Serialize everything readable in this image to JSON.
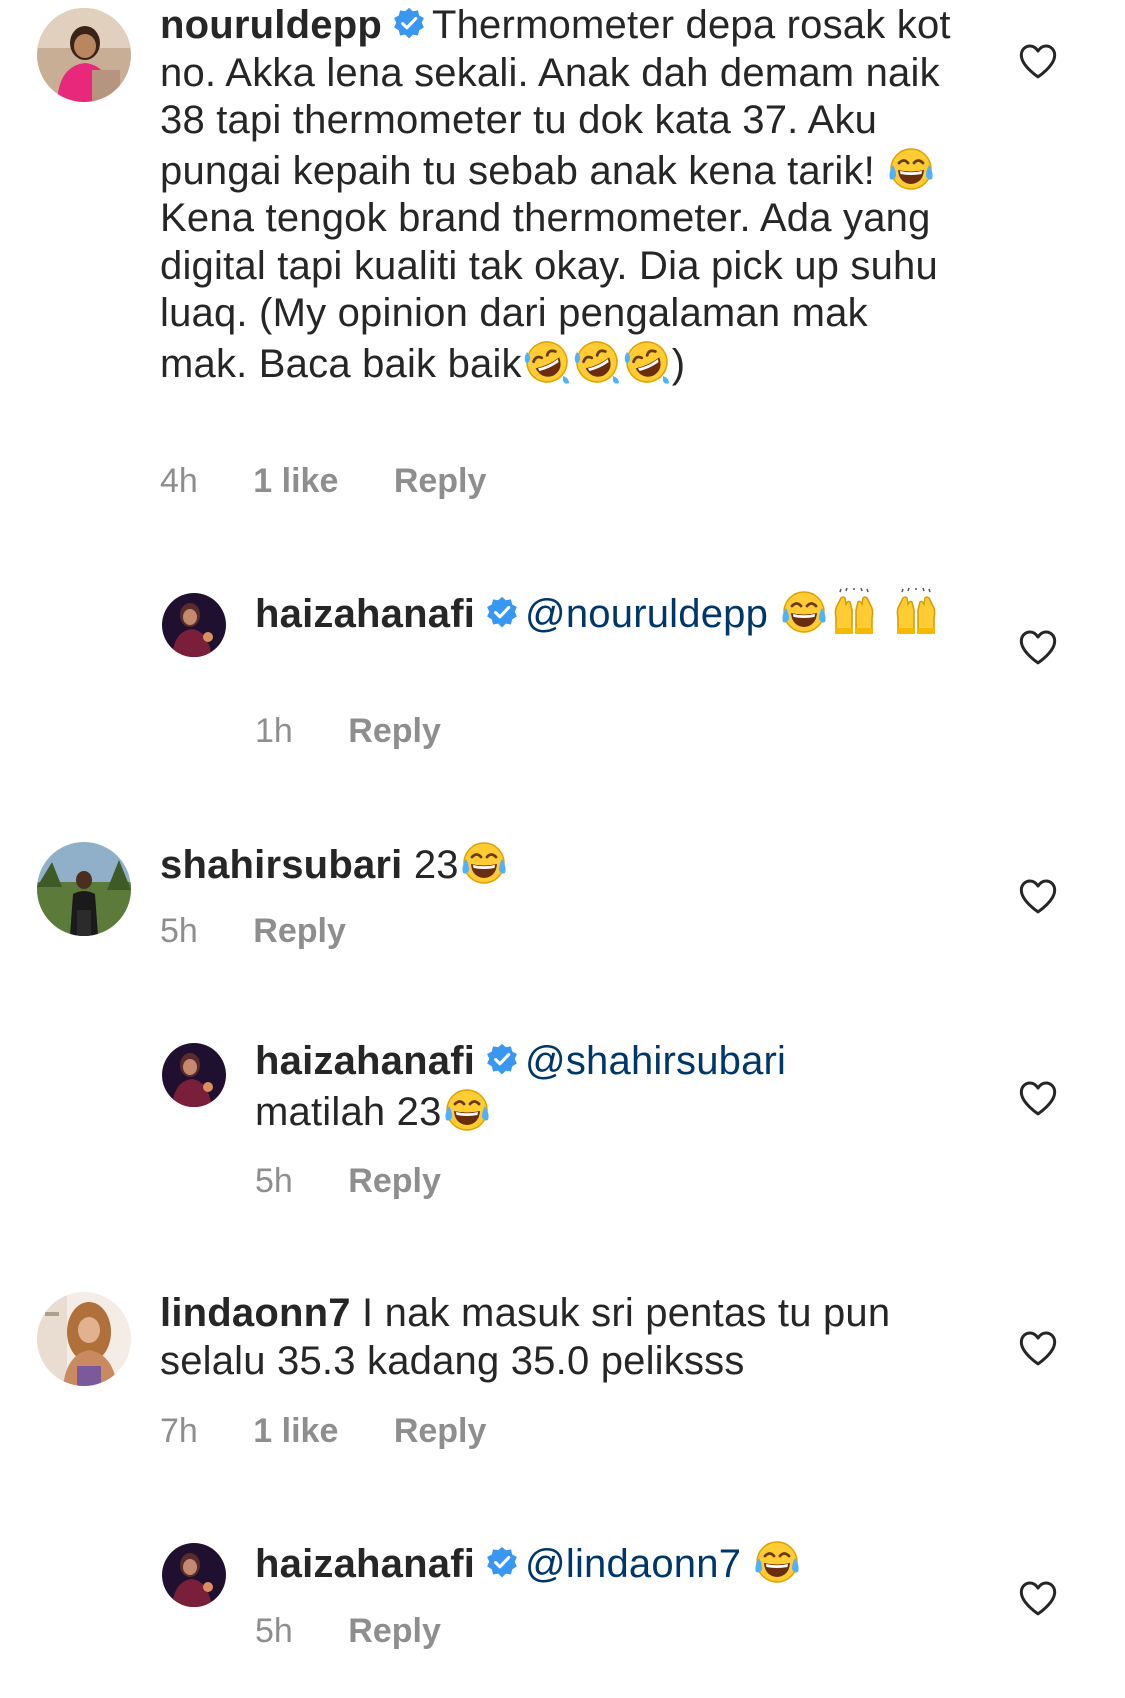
{
  "comments": [
    {
      "username": "nouruldepp",
      "verified": true,
      "text_a": "Thermometer depa rosak kot no. Akka lena sekali. Anak dah demam naik 38 tapi thermometer tu dok kata 37. Aku pungai kepaih tu sebab anak kena tarik!",
      "emoji_1": "face-with-tears-of-joy",
      "text_b": "Kena tengok brand thermometer. Ada yang digital tapi kualiti tak okay. Dia pick up suhu luaq. (My opinion dari pengalaman mak mak.  Baca baik baik",
      "emoji_2": "rolling-on-floor-laughing x3",
      "text_c": ")",
      "time": "4h",
      "likes": "1 like",
      "reply_label": "Reply"
    },
    {
      "username": "haizahanafi",
      "verified": true,
      "mention": "@nouruldepp",
      "emoji": "face-with-tears-of-joy, raising-hands x2",
      "time": "1h",
      "reply_label": "Reply"
    },
    {
      "username": "shahirsubari",
      "text": "23",
      "emoji": "face-with-tears-of-joy",
      "time": "5h",
      "reply_label": "Reply"
    },
    {
      "username": "haizahanafi",
      "verified": true,
      "mention": "@shahirsubari",
      "text": "matilah 23",
      "emoji": "face-with-tears-of-joy",
      "time": "5h",
      "reply_label": "Reply"
    },
    {
      "username": "lindaonn7",
      "text": "I nak masuk sri pentas tu pun selalu 35.3 kadang 35.0 peliksss",
      "time": "7h",
      "likes": "1 like",
      "reply_label": "Reply"
    },
    {
      "username": "haizahanafi",
      "verified": true,
      "mention": "@lindaonn7",
      "emoji": "face-with-tears-of-joy",
      "time": "5h",
      "reply_label": "Reply"
    }
  ],
  "colors": {
    "verified": "#3897f0",
    "mention": "#00376b",
    "meta": "#8e8e8e",
    "text": "#262626"
  }
}
